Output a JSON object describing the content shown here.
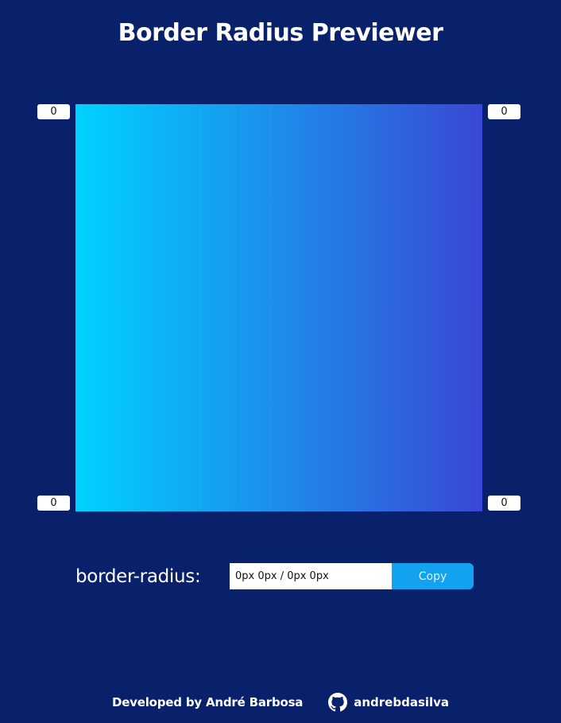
{
  "header": {
    "title": "Border Radius Previewer"
  },
  "corners": {
    "top_left": "0",
    "top_right": "0",
    "bottom_left": "0",
    "bottom_right": "0"
  },
  "preview": {
    "gradient_start": "#00d2ff",
    "gradient_end": "#3a47d5"
  },
  "output": {
    "label": "border-radius:",
    "value": "0px 0px / 0px 0px",
    "copy_label": "Copy"
  },
  "footer": {
    "credit": "Developed by André Barbosa",
    "github_icon": "github-icon",
    "github_user": "andrebdasilva"
  },
  "colors": {
    "background": "#09216b",
    "copy_button": "#12a2ef"
  }
}
